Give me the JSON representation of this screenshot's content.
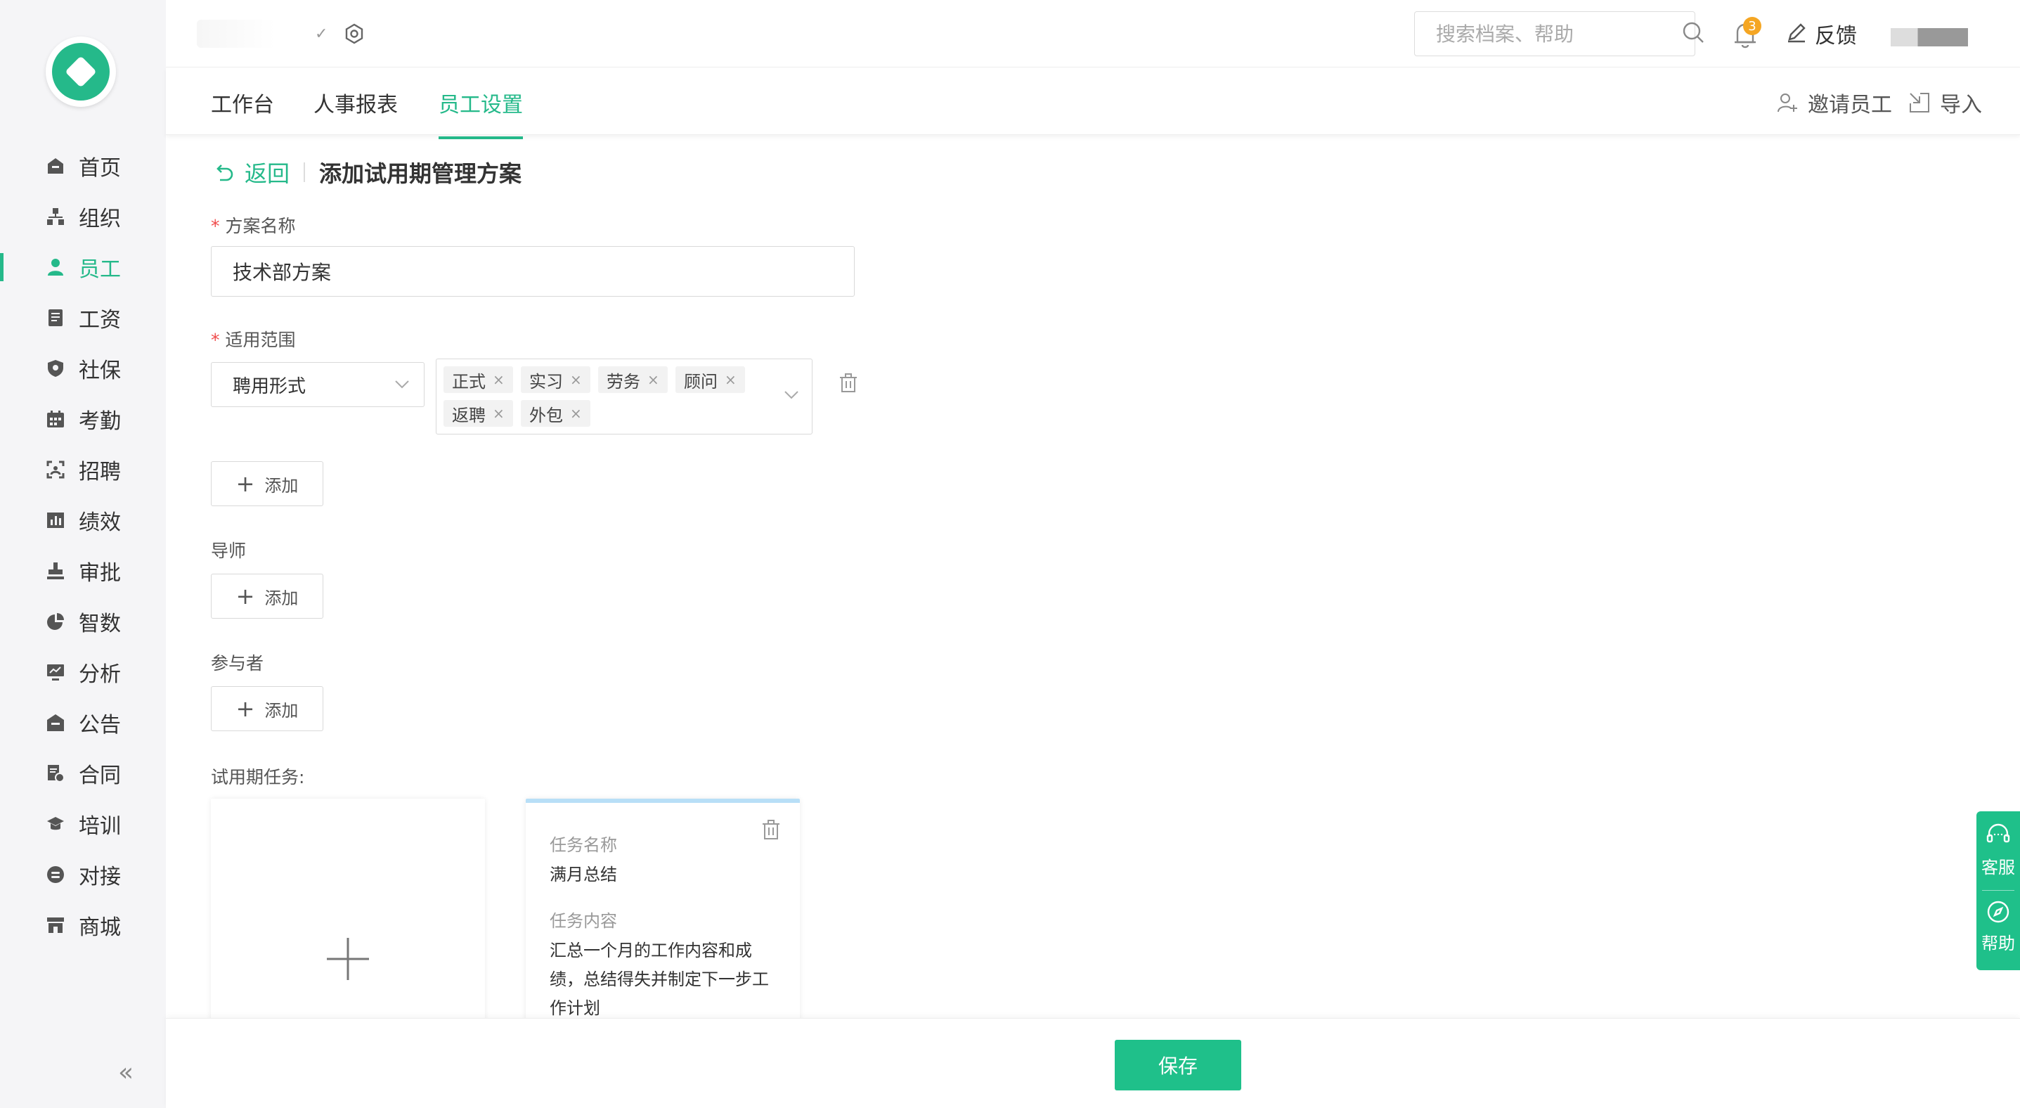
{
  "sidebar": {
    "items": [
      {
        "label": "首页",
        "icon": "home-icon"
      },
      {
        "label": "组织",
        "icon": "org-icon"
      },
      {
        "label": "员工",
        "icon": "user-icon"
      },
      {
        "label": "工资",
        "icon": "salary-icon"
      },
      {
        "label": "社保",
        "icon": "shield-icon"
      },
      {
        "label": "考勤",
        "icon": "calendar-icon"
      },
      {
        "label": "招聘",
        "icon": "scan-icon"
      },
      {
        "label": "绩效",
        "icon": "bar-chart-icon"
      },
      {
        "label": "审批",
        "icon": "stamp-icon"
      },
      {
        "label": "智数",
        "icon": "pie-chart-icon"
      },
      {
        "label": "分析",
        "icon": "monitor-icon"
      },
      {
        "label": "公告",
        "icon": "announcement-icon"
      },
      {
        "label": "合同",
        "icon": "contract-icon"
      },
      {
        "label": "培训",
        "icon": "graduation-cap-icon"
      },
      {
        "label": "对接",
        "icon": "link-icon"
      },
      {
        "label": "商城",
        "icon": "store-icon"
      }
    ],
    "active_index": 2,
    "collapse_glyph": "«"
  },
  "header": {
    "edit_glyph": "✓",
    "search_placeholder": "搜索档案、帮助",
    "notification_count": "3",
    "feedback_label": "反馈"
  },
  "tabs": [
    {
      "label": "工作台"
    },
    {
      "label": "人事报表"
    },
    {
      "label": "员工设置"
    }
  ],
  "top_actions": {
    "invite": "邀请员工",
    "import": "导入"
  },
  "form": {
    "back_label": "返回",
    "page_title": "添加试用期管理方案",
    "required_mark": "*",
    "plan_name_label": "方案名称",
    "plan_name_value": "技术部方案",
    "scope_label": "适用范围",
    "scope_type": "聘用形式",
    "scope_tags": [
      "正式",
      "实习",
      "劳务",
      "顾问",
      "返聘",
      "外包"
    ],
    "chip_close": "×",
    "add_label": "添加",
    "plus_glyph": "+",
    "mentor_label": "导师",
    "participants_label": "参与者",
    "tasks_label": "试用期任务:",
    "task": {
      "name_label": "任务名称",
      "name_value": "满月总结",
      "content_label": "任务内容",
      "content_value": "汇总一个月的工作内容和成绩，总结得失并制定下一步工作计划"
    }
  },
  "footer": {
    "save_label": "保存"
  },
  "float_panel": {
    "service_label": "客服",
    "help_label": "帮助"
  },
  "colors": {
    "accent": "#25b98a",
    "save_button": "#1fc08a",
    "badge": "#f5a623",
    "required": "#f04b4b"
  }
}
